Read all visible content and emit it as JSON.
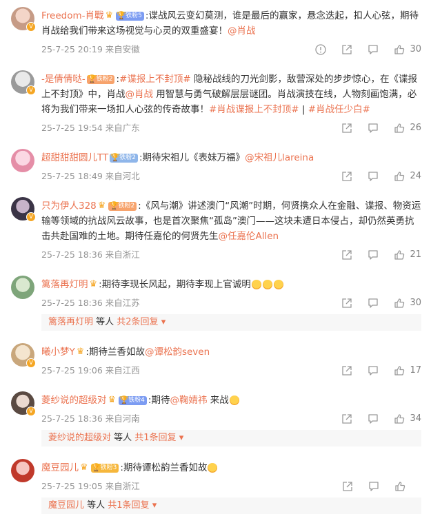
{
  "comments": [
    {
      "name": "Freedom-肖戰",
      "badge": "铁粉5",
      "badge_color": "#7c9cf2",
      "text_a": ":谍战风云变幻莫测，谁是最后的赢家，悬念迭起，扣人心弦，期待肖战给我们带来这场视觉与心灵的双重盛宴！",
      "mention_a": "@肖战",
      "time": "25-7-25 20:19 来自安徽",
      "likes": "30",
      "avatar_colors": [
        "#c69b86",
        "#f3d5c8"
      ]
    },
    {
      "name": "-是倩倩哒-",
      "badge": "铁粉2",
      "badge_color": "#f7a36c",
      "text_a": ":",
      "topic_a": "#谍报上不封顶#",
      "text_b": " 隐秘战线的刀光剑影，敌营深处的步步惊心，在《谍报上不封顶》中，肖战",
      "mention_a": "@肖战",
      "text_c": " 用智慧与勇气破解层层谜团。肖战演技在线，人物刻画饱满，必将为我们带来一场扣人心弦的传奇故事！",
      "topic_b": "#肖战谍报上不封顶#",
      "text_d": " | ",
      "topic_c": "#肖战任少白#",
      "time": "25-7-25 19:54 来自广东",
      "likes": "26",
      "avatar_colors": [
        "#9a9a9a",
        "#e9e9e9"
      ]
    },
    {
      "name": "超甜甜甜圆儿TT",
      "badge": "铁粉2",
      "badge_color": "#8fb6ea",
      "text_a": ":期待宋祖儿《表妹万福》",
      "mention_a": "@宋祖儿lareina",
      "time": "25-7-25 18:49 来自河北",
      "likes": "24",
      "avatar_colors": [
        "#e58ea7",
        "#fbd8e3"
      ]
    },
    {
      "name": "只为伊人328",
      "badge": "铁粉2",
      "badge_color": "#f7a36c",
      "text_a": ":《风与潮》讲述澳门“风潮”时期，何贤携众人在金融、谍报、物资运输等领域的抗战风云故事，也是首次聚焦“孤岛”澳门——这块未遭日本侵占，却仍然英勇抗击共赴国难的土地。期待任嘉伦的何贤先生",
      "mention_a": "@任嘉伦Allen",
      "time": "25-7-25 18:36 来自浙江",
      "likes": "21",
      "avatar_colors": [
        "#3b3446",
        "#c7b3c9"
      ]
    },
    {
      "name": "篱落再灯明",
      "text_a": ":期待李现长风起，期待李现上官诚明",
      "time": "25-7-25 18:36 来自江苏",
      "likes": "30",
      "reply_name": "篱落再灯明",
      "reply_mid": " 等人 ",
      "reply_count": "共2条回复",
      "avatar_colors": [
        "#7ea57a",
        "#d9e8cf"
      ]
    },
    {
      "name": "曦小梦Y",
      "text_a": ":期待兰香如故",
      "mention_a": "@谭松韵seven",
      "time": "25-7-25 19:06 来自江西",
      "likes": "17",
      "avatar_colors": [
        "#c9a77c",
        "#f4e5cf"
      ]
    },
    {
      "name": "菱纱说的超级对",
      "badge": "铁粉4",
      "badge_color": "#7c9cf2",
      "text_a": ":期待",
      "mention_a": "@鞠婧祎",
      "text_b": " 来战",
      "time": "25-7-25 18:36 来自河南",
      "likes": "34",
      "reply_name": "菱纱说的超级对",
      "reply_mid": " 等人 ",
      "reply_count": "共1条回复",
      "avatar_colors": [
        "#5a4a42",
        "#ead9cf"
      ]
    },
    {
      "name": "魔豆园儿",
      "badge": "铁粉3",
      "badge_color": "#f6b73c",
      "text_a": ":期待谭松韵兰香如故",
      "time": "25-7-25 19:05 来自浙江",
      "likes": "",
      "reply_name": "魔豆园儿",
      "reply_mid": " 等人 ",
      "reply_count": "共1条回复",
      "avatar_colors": [
        "#c0392b",
        "#f6c5c0"
      ]
    }
  ],
  "colors": {
    "accent": "#eb7350",
    "meta": "#939393",
    "reply_bg": "#f7f7f7"
  },
  "icons": [
    "warning-icon",
    "share-icon",
    "comment-icon",
    "like-icon",
    "crown-icon",
    "fan-badge-icon"
  ]
}
